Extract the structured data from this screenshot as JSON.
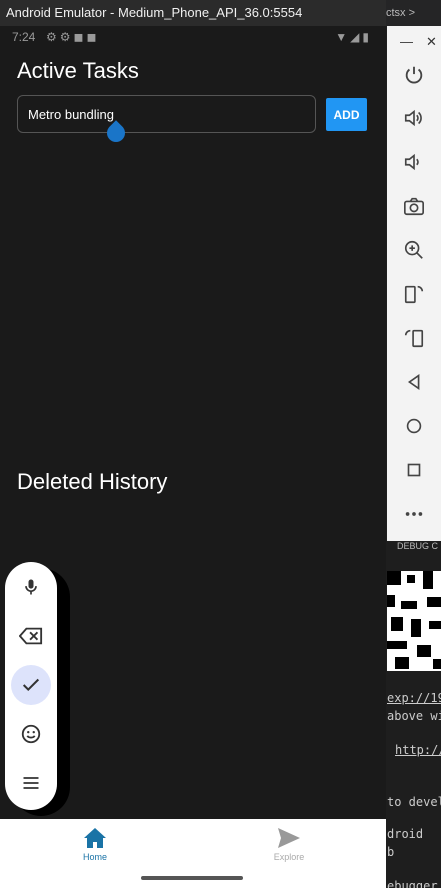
{
  "window": {
    "title": "Android Emulator - Medium_Phone_API_36.0:5554"
  },
  "ide": {
    "tab_fragment": "ctsx >"
  },
  "status_bar": {
    "time": "7:24"
  },
  "app": {
    "active_title": "Active Tasks",
    "task_input_value": "Metro bundling",
    "add_label": "ADD",
    "deleted_title": "Deleted History"
  },
  "nav": {
    "home_label": "Home",
    "explore_label": "Explore"
  },
  "debug": {
    "header": "DEBUG C",
    "lines": [
      "exp://19",
      "above wi",
      "http://",
      "to devel",
      "droid",
      "b",
      "ebugger"
    ]
  },
  "colors": {
    "accent": "#2196f3",
    "nav_active": "#1a73a6"
  }
}
